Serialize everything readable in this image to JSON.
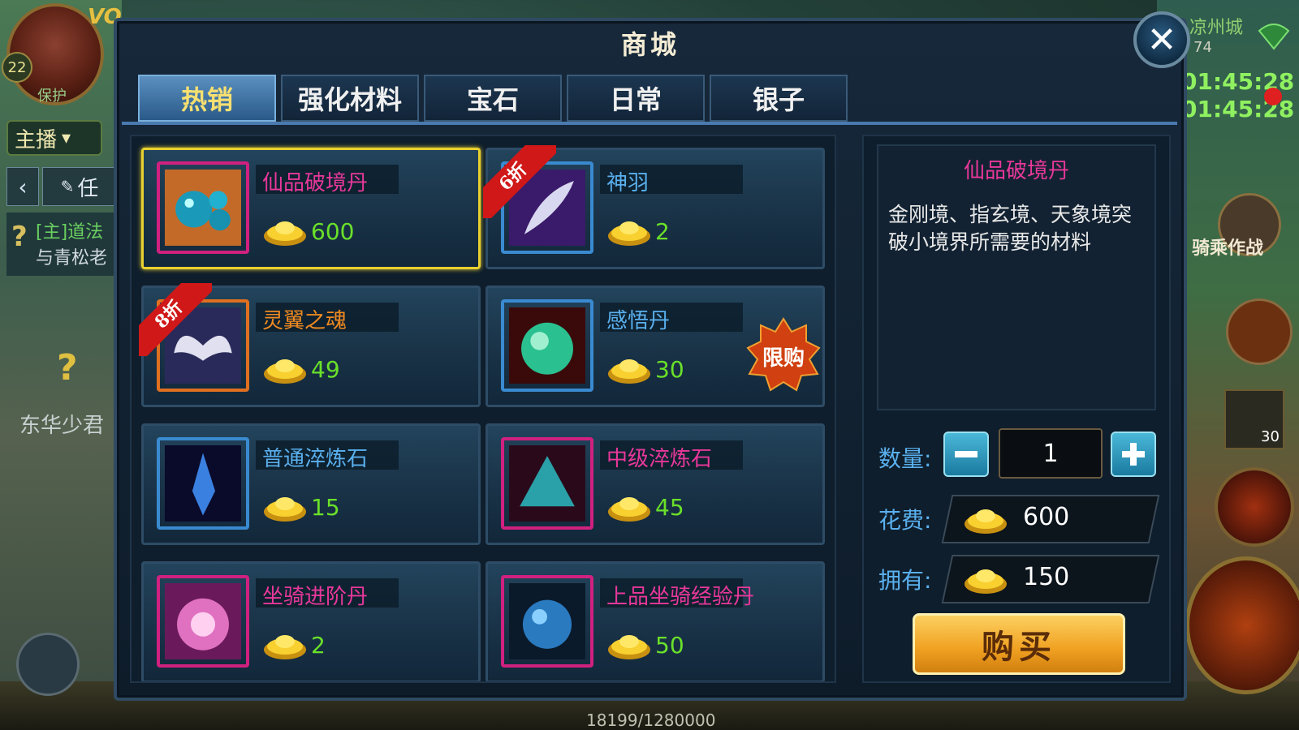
{
  "hud": {
    "vip": "VO",
    "level": "22",
    "protect": "保护",
    "broadcast": "主播",
    "quest_tab": "任",
    "quest_line1": "[主]道法",
    "quest_line2": "与青松老",
    "npc_name": "东华少君",
    "city": "凉州城",
    "coord": "74",
    "timer1": "01:45:28",
    "timer2": "01:45:28",
    "ride_battle": "骑乘作战",
    "slot_count": "30",
    "exp": "18199/1280000"
  },
  "shop": {
    "title": "商城",
    "tabs": [
      {
        "label": "热销",
        "active": true
      },
      {
        "label": "强化材料",
        "active": false
      },
      {
        "label": "宝石",
        "active": false
      },
      {
        "label": "日常",
        "active": false
      },
      {
        "label": "银子",
        "active": false
      }
    ],
    "items": [
      {
        "name": "仙品破境丹",
        "price": "600",
        "name_color": "#e8389a",
        "icon": "spirit-orbs-icon",
        "frame": "#d02080",
        "selected": true,
        "discount": "",
        "limited": false
      },
      {
        "name": "神羽",
        "price": "2",
        "name_color": "#5ab0ee",
        "icon": "feather-icon",
        "frame": "#3a8ad0",
        "selected": false,
        "discount": "6折",
        "limited": false
      },
      {
        "name": "灵翼之魂",
        "price": "49",
        "name_color": "#f08a20",
        "icon": "wings-icon",
        "frame": "#e07020",
        "selected": false,
        "discount": "8折",
        "limited": false
      },
      {
        "name": "感悟丹",
        "price": "30",
        "name_color": "#5ab0ee",
        "icon": "green-pearl-icon",
        "frame": "#3a8ad0",
        "selected": false,
        "discount": "",
        "limited": true,
        "limited_label": "限购"
      },
      {
        "name": "普通淬炼石",
        "price": "15",
        "name_color": "#5ab0ee",
        "icon": "blue-crystal-icon",
        "frame": "#3a8ad0",
        "selected": false,
        "discount": "",
        "limited": false
      },
      {
        "name": "中级淬炼石",
        "price": "45",
        "name_color": "#e8389a",
        "icon": "teal-gem-icon",
        "frame": "#d02080",
        "selected": false,
        "discount": "",
        "limited": false
      },
      {
        "name": "坐骑进阶丹",
        "price": "2",
        "name_color": "#e8389a",
        "icon": "pink-orb-icon",
        "frame": "#d02080",
        "selected": false,
        "discount": "",
        "limited": false
      },
      {
        "name": "上品坐骑经验丹",
        "price": "50",
        "name_color": "#e8389a",
        "icon": "blue-orb-icon",
        "frame": "#d02080",
        "selected": false,
        "discount": "",
        "limited": false
      }
    ],
    "detail": {
      "name": "仙品破境丹",
      "description": "金刚境、指玄境、天象境突破小境界所需要的材料",
      "qty_label": "数量:",
      "qty": "1",
      "cost_label": "花费:",
      "cost": "600",
      "own_label": "拥有:",
      "own": "150",
      "buy_label": "购买"
    }
  },
  "colors": {
    "price_green": "#6ae02a",
    "selected_border": "#e8d030",
    "tab_active": "#f8e070"
  }
}
